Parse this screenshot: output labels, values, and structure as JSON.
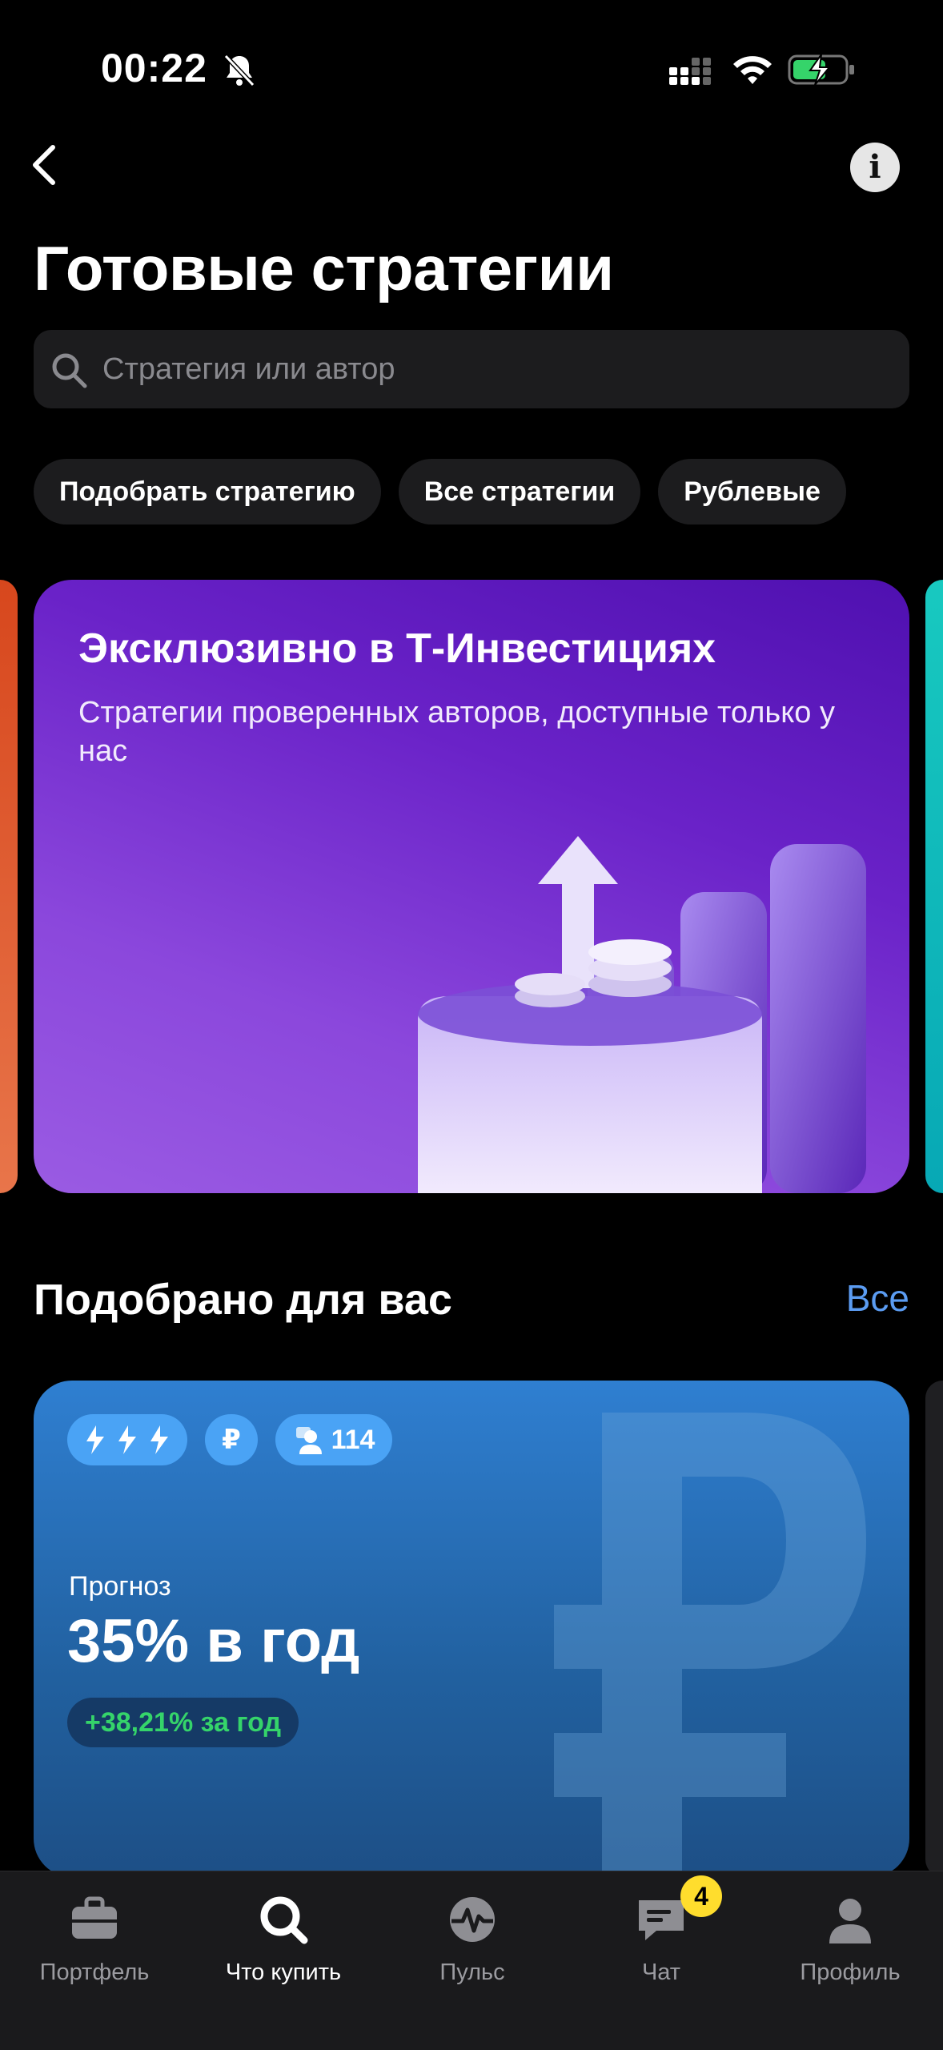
{
  "status_bar": {
    "time": "00:22"
  },
  "header": {
    "title": "Готовые стратегии"
  },
  "search": {
    "placeholder": "Стратегия или автор"
  },
  "chips": [
    "Подобрать стратегию",
    "Все стратегии",
    "Рублевые"
  ],
  "promo": {
    "title": "Эксклюзивно в Т-Инвестициях",
    "subtitle": "Стратегии проверенных авторов, доступные только у нас"
  },
  "section": {
    "title": "Подобрано для вас",
    "all_label": "Все"
  },
  "strategy_card": {
    "badge_currency": "₽",
    "subscribers": "114",
    "forecast_label": "Прогноз",
    "forecast_value": "35% в год",
    "return_label": "+38,21% за год"
  },
  "tabbar": {
    "tabs": [
      {
        "label": "Портфель",
        "icon": "briefcase-icon"
      },
      {
        "label": "Что купить",
        "icon": "search-icon",
        "active": true
      },
      {
        "label": "Пульс",
        "icon": "pulse-icon"
      },
      {
        "label": "Чат",
        "icon": "chat-icon",
        "badge": "4"
      },
      {
        "label": "Профиль",
        "icon": "profile-icon"
      }
    ]
  },
  "colors": {
    "accent_link": "#5b9cf2",
    "chat_badge": "#ffdd2d",
    "positive": "#35d46a"
  }
}
